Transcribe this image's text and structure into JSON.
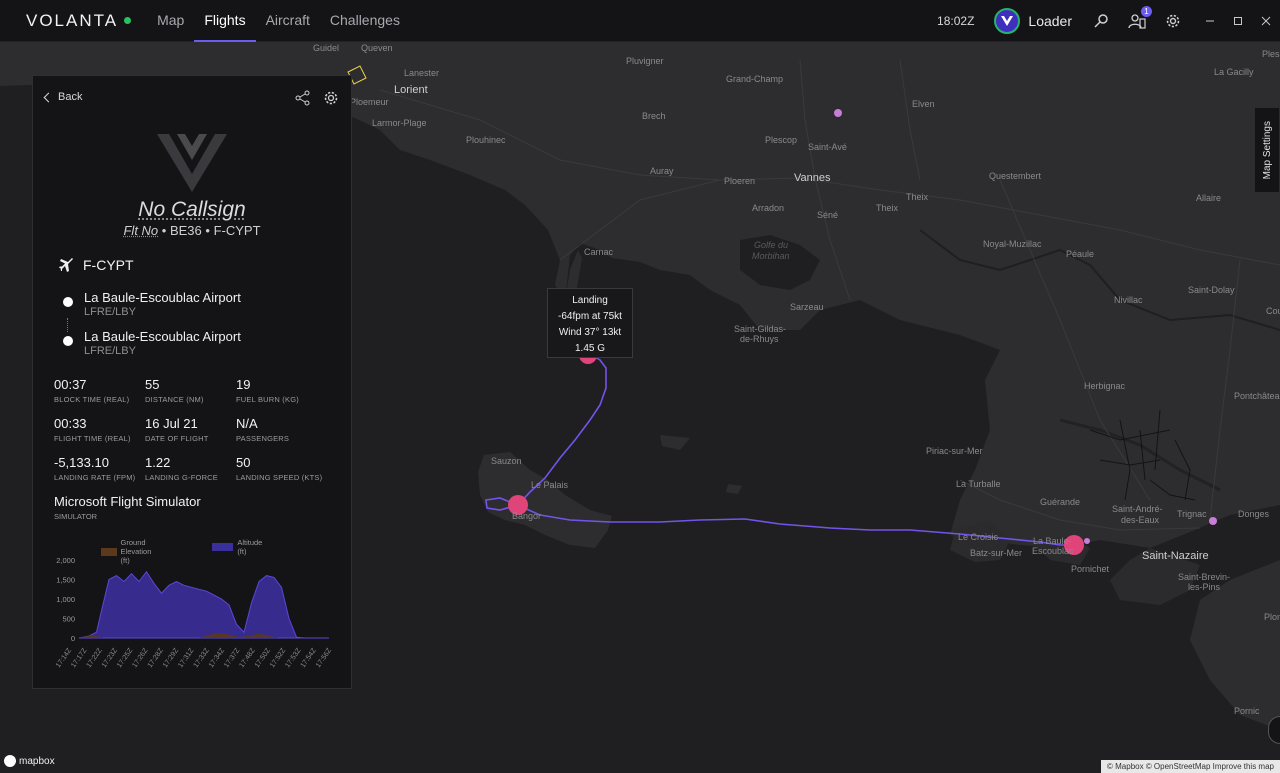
{
  "app": {
    "name": "VOLANTA",
    "status_color": "#22c55e",
    "accent": "#6d5cf0"
  },
  "nav": {
    "items": [
      "Map",
      "Flights",
      "Aircraft",
      "Challenges"
    ],
    "active": "Flights"
  },
  "topbar": {
    "clock": "18:02Z",
    "user_name": "Loader",
    "notification_count": "1"
  },
  "panel": {
    "back_label": "Back",
    "callsign": "No Callsign",
    "flt_no_label": "Flt No",
    "aircraft_type": "BE36",
    "registration": "F-CYPT",
    "aircraft_registration": "F-CYPT",
    "departure": {
      "name": "La Baule-Escoublac Airport",
      "codes": "LFRE/LBY"
    },
    "arrival": {
      "name": "La Baule-Escoublac Airport",
      "codes": "LFRE/LBY"
    },
    "stats": [
      {
        "value": "00:37",
        "label": "BLOCK TIME (REAL)"
      },
      {
        "value": "55",
        "label": "DISTANCE (NM)"
      },
      {
        "value": "19",
        "label": "FUEL BURN (KG)"
      },
      {
        "value": "00:33",
        "label": "FLIGHT TIME (REAL)"
      },
      {
        "value": "16 Jul 21",
        "label": "DATE OF FLIGHT"
      },
      {
        "value": "N/A",
        "label": "PASSENGERS"
      },
      {
        "value": "-5,133.10",
        "label": "LANDING RATE (FPM)"
      },
      {
        "value": "1.22",
        "label": "LANDING G-FORCE"
      },
      {
        "value": "50",
        "label": "LANDING SPEED (KTS)"
      }
    ],
    "simulator": {
      "value": "Microsoft Flight Simulator",
      "label": "SIMULATOR"
    }
  },
  "chart_data": {
    "type": "area",
    "legend": [
      "Ground Elevation (ft)",
      "Altitude (ft)"
    ],
    "legend_position": "top",
    "colors": {
      "ground": "#5a3a1a",
      "altitude": "#3b2f9a"
    },
    "y_ticks": [
      "0",
      "500",
      "1,000",
      "1,500",
      "2,000"
    ],
    "ylim": [
      0,
      2000
    ],
    "x_ticks": [
      "17:14Z",
      "17:17Z",
      "17:22Z",
      "17:23Z",
      "17:25Z",
      "17:26Z",
      "17:28Z",
      "17:29Z",
      "17:31Z",
      "17:33Z",
      "17:34Z",
      "17:37Z",
      "17:48Z",
      "17:50Z",
      "17:52Z",
      "17:53Z",
      "17:54Z",
      "17:56Z"
    ],
    "series": [
      {
        "name": "Altitude (ft)",
        "x": [
          0,
          0.04,
          0.07,
          0.09,
          0.12,
          0.15,
          0.18,
          0.21,
          0.24,
          0.27,
          0.3,
          0.33,
          0.36,
          0.39,
          0.42,
          0.45,
          0.48,
          0.51,
          0.54,
          0.57,
          0.6,
          0.63,
          0.66,
          0.69,
          0.72,
          0.75,
          0.78,
          0.81,
          0.84,
          0.87,
          0.9,
          0.93,
          1.0
        ],
        "values": [
          0,
          50,
          150,
          700,
          1500,
          1600,
          1450,
          1650,
          1450,
          1700,
          1400,
          1150,
          1350,
          1450,
          1350,
          1300,
          1250,
          1200,
          1100,
          1000,
          850,
          350,
          150,
          900,
          1450,
          1600,
          1550,
          1300,
          500,
          20,
          0,
          0,
          0
        ]
      },
      {
        "name": "Ground Elevation (ft)",
        "x": [
          0,
          0.05,
          0.1,
          0.48,
          0.52,
          0.56,
          0.6,
          0.64,
          0.68,
          0.72,
          0.76,
          0.8,
          1.0
        ],
        "values": [
          0,
          80,
          0,
          0,
          80,
          130,
          90,
          20,
          60,
          110,
          60,
          0,
          0
        ]
      }
    ]
  },
  "map": {
    "tooltip": {
      "line1": "Landing",
      "line2": "-64fpm at 75kt",
      "line3": "Wind 37° 13kt",
      "line4": "1.45 G"
    },
    "settings_label": "Map Settings",
    "mapbox_label": "mapbox",
    "attribution": "© Mapbox © OpenStreetMap Improve this map",
    "places": [
      {
        "name": "Guidel",
        "cls": ""
      },
      {
        "name": "Queven",
        "cls": ""
      },
      {
        "name": "Lanester",
        "cls": ""
      },
      {
        "name": "Lorient",
        "cls": "big"
      },
      {
        "name": "Ploemeur",
        "cls": ""
      },
      {
        "name": "Larmor-Plage",
        "cls": ""
      },
      {
        "name": "Pluvigner",
        "cls": ""
      },
      {
        "name": "Grand-Champ",
        "cls": ""
      },
      {
        "name": "Brech",
        "cls": ""
      },
      {
        "name": "Elven",
        "cls": ""
      },
      {
        "name": "La Gacilly",
        "cls": ""
      },
      {
        "name": "Plouhinec",
        "cls": ""
      },
      {
        "name": "Plescop",
        "cls": ""
      },
      {
        "name": "Saint-Avé",
        "cls": ""
      },
      {
        "name": "Auray",
        "cls": ""
      },
      {
        "name": "Ploeren",
        "cls": ""
      },
      {
        "name": "Vannes",
        "cls": "big"
      },
      {
        "name": "Questembert",
        "cls": ""
      },
      {
        "name": "Theix",
        "cls": ""
      },
      {
        "name": "Theix",
        "cls": ""
      },
      {
        "name": "Allaire",
        "cls": ""
      },
      {
        "name": "Arradon",
        "cls": ""
      },
      {
        "name": "Séné",
        "cls": ""
      },
      {
        "name": "Golfe du",
        "cls": "water"
      },
      {
        "name": "Morbihan",
        "cls": "water"
      },
      {
        "name": "Noyal-Muzillac",
        "cls": ""
      },
      {
        "name": "Péaule",
        "cls": ""
      },
      {
        "name": "Carnac",
        "cls": ""
      },
      {
        "name": "Sarzeau",
        "cls": ""
      },
      {
        "name": "Saint-Dolay",
        "cls": ""
      },
      {
        "name": "Nivillac",
        "cls": ""
      },
      {
        "name": "Saint-Gildas-",
        "cls": ""
      },
      {
        "name": "de-Rhuys",
        "cls": ""
      },
      {
        "name": "Herbignac",
        "cls": ""
      },
      {
        "name": "Pontchâteau",
        "cls": ""
      },
      {
        "name": "Sauzon",
        "cls": ""
      },
      {
        "name": "Le Palais",
        "cls": ""
      },
      {
        "name": "Bangor",
        "cls": ""
      },
      {
        "name": "Piriac-sur-Mer",
        "cls": ""
      },
      {
        "name": "La Turballe",
        "cls": ""
      },
      {
        "name": "Guérande",
        "cls": ""
      },
      {
        "name": "Saint-André-",
        "cls": ""
      },
      {
        "name": "des-Eaux",
        "cls": ""
      },
      {
        "name": "Trignac",
        "cls": ""
      },
      {
        "name": "Donges",
        "cls": ""
      },
      {
        "name": "Le Croisic",
        "cls": ""
      },
      {
        "name": "Batz-sur-Mer",
        "cls": ""
      },
      {
        "name": "La Baule-",
        "cls": ""
      },
      {
        "name": "Escoublac",
        "cls": ""
      },
      {
        "name": "Pornichet",
        "cls": ""
      },
      {
        "name": "Saint-Nazaire",
        "cls": "big"
      },
      {
        "name": "Saint-Brevin-",
        "cls": ""
      },
      {
        "name": "les-Pins",
        "cls": ""
      },
      {
        "name": "Plesse",
        "cls": ""
      },
      {
        "name": "Plomb",
        "cls": ""
      },
      {
        "name": "Coueron",
        "cls": ""
      },
      {
        "name": "Pornic",
        "cls": ""
      }
    ]
  }
}
